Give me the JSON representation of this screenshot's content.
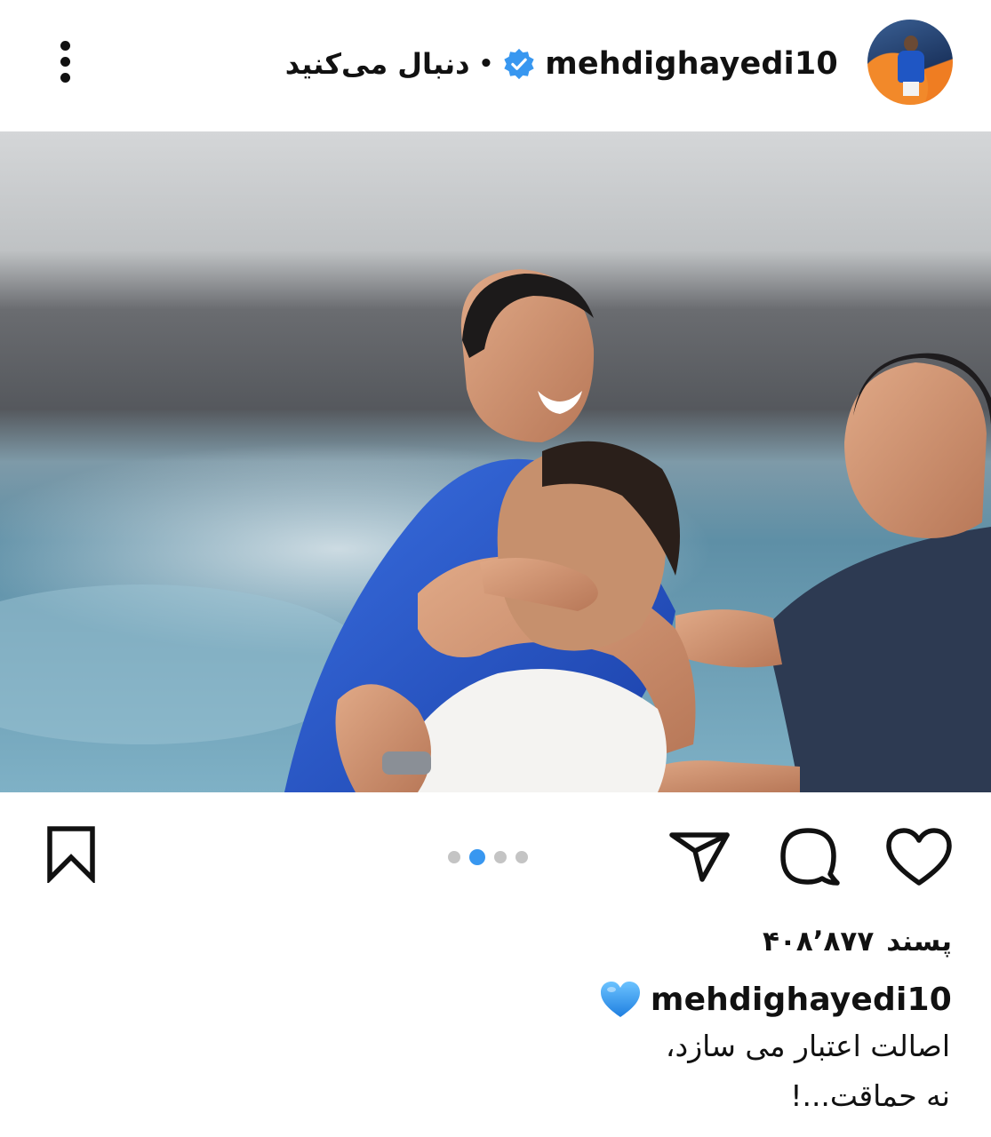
{
  "header": {
    "username": "mehdighayedi10",
    "separator": "•",
    "following_label": "دنبال می‌کنید",
    "verified": true
  },
  "pager": {
    "total": 4,
    "active_index": 1
  },
  "likes": {
    "count": "۴۰۸٬۸۷۷",
    "label": "پسند"
  },
  "caption": {
    "username": "mehdighayedi10",
    "emoji": "blue-heart",
    "lines": [
      "اصالت اعتبار می سازد،",
      "نه حماقت...!"
    ]
  },
  "icons": {
    "menu": "more-vertical-icon",
    "verified": "verified-badge-icon",
    "like": "heart-icon",
    "comment": "comment-icon",
    "share": "send-icon",
    "save": "bookmark-icon"
  },
  "colors": {
    "verified_blue": "#3897f0",
    "pager_active": "#3897f0",
    "pager_inactive": "#c4c4c4",
    "jersey_blue": "#1f4fc8",
    "heart_blue": "#3aa0f0"
  }
}
